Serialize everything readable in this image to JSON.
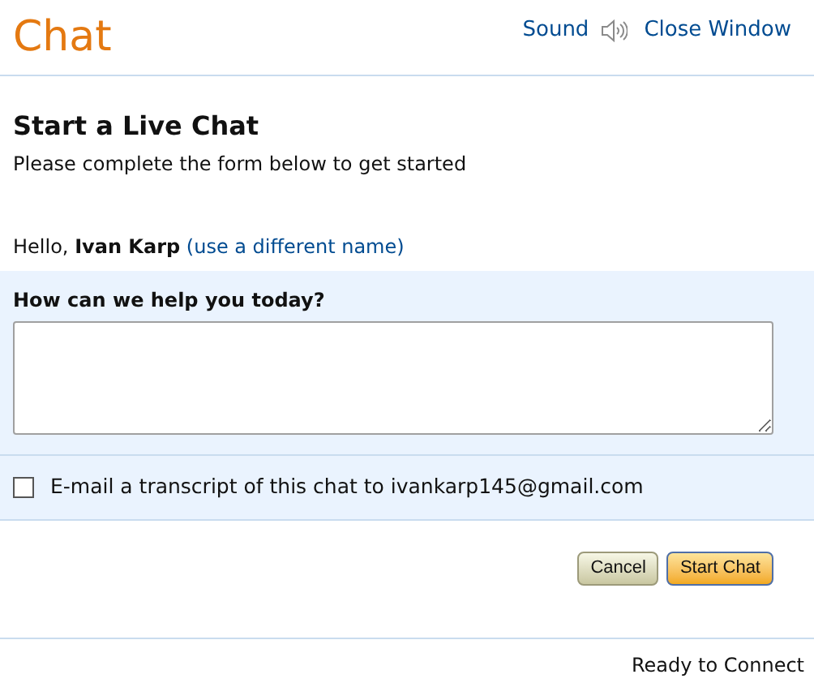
{
  "header": {
    "title": "Chat",
    "sound_label": "Sound",
    "sound_on": true,
    "close_label": "Close Window"
  },
  "intro": {
    "heading": "Start a Live Chat",
    "subtitle": "Please complete the form below to get started"
  },
  "greeting": {
    "prefix": "Hello,",
    "name": "Ivan Karp",
    "link": "(use a different name)"
  },
  "question": {
    "label": "How can we help you today?"
  },
  "transcript": {
    "label": "E-mail a transcript of this chat to ivankarp145@gmail.com",
    "checked": false
  },
  "buttons": [
    {
      "label": "Cancel",
      "kind": "secondary"
    },
    {
      "label": "Start Chat",
      "kind": "primary"
    }
  ],
  "status_bar": "Ready to Connect"
}
